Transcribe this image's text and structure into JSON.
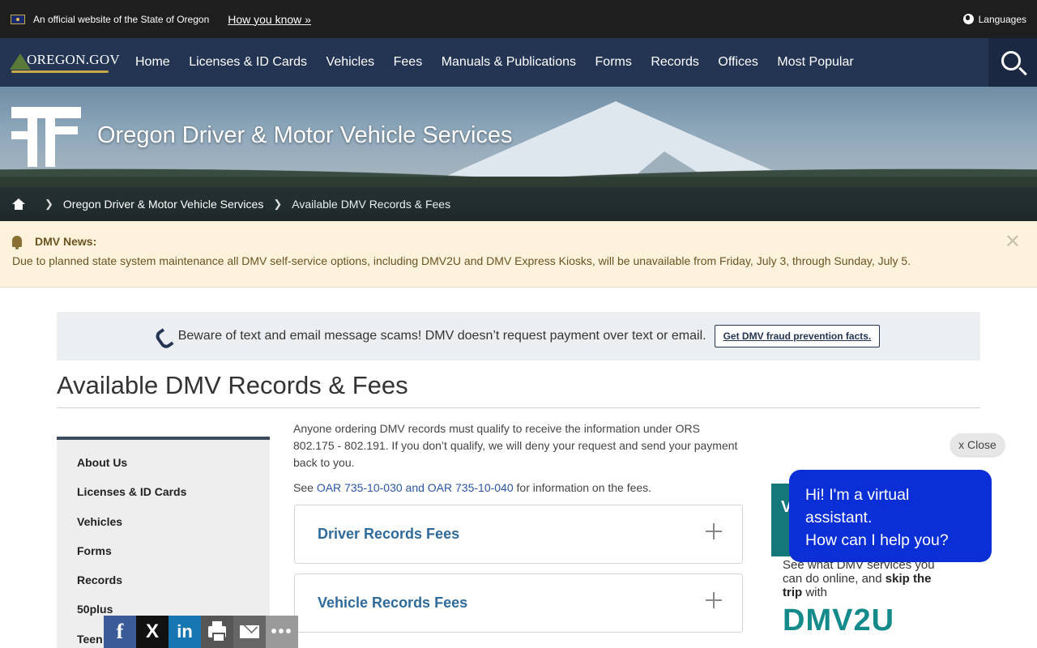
{
  "topbar": {
    "official_text": "An official website of the State of Oregon",
    "how_you_know": "How you know »",
    "languages": "Languages"
  },
  "nav": {
    "logo_text": "OREGON.GOV",
    "items": [
      "Home",
      "Licenses & ID Cards",
      "Vehicles",
      "Fees",
      "Manuals & Publications",
      "Forms",
      "Records",
      "Offices",
      "Most Popular"
    ]
  },
  "hero": {
    "title": "Oregon Driver & Motor Vehicle Services",
    "breadcrumb": [
      "Oregon Driver & Motor Vehicle Services",
      "Available DMV Records & Fees"
    ]
  },
  "alert": {
    "label": "DMV News:",
    "message": "Due to planned state system maintenance all DMV self-service options, including DMV2U and DMV Express Kiosks, will be unavailable from Friday, July 3, through Sunday, July 5.",
    "close": "✕"
  },
  "scam": {
    "text": "Beware of text and email message scams! DMV doesn’t request payment over text or email.",
    "button": "Get DMV fraud prevention facts."
  },
  "page_title": "Available DMV Records & Fees",
  "sidebar": {
    "items": [
      "About Us",
      "Licenses & ID Cards",
      "Vehicles",
      "Forms",
      "Records",
      "50plus",
      "Teen"
    ]
  },
  "content": {
    "intro": "Anyone ordering DMV records must qualify to receive the information under ORS 802.175 - 802.191. If you don’t qualify, we will deny your request and send your payment back to you.",
    "see_prefix": "See ",
    "see_link": "OAR 735-10-030 and OAR 735-10-040",
    "see_suffix": " for information on the fees.",
    "accordions": [
      "Driver Records Fees",
      "Vehicle Records Fees"
    ]
  },
  "promo": {
    "letter": "V",
    "line1": "See what DMV services you can do online, and",
    "bold": "skip the trip",
    "line2": " with",
    "brand": "DMV2U"
  },
  "chat": {
    "close": "x Close",
    "line1": "Hi! I'm a virtual assistant.",
    "line2": "How can I help you?"
  },
  "share": {
    "facebook": "f",
    "x": "X",
    "linkedin": "in",
    "more": "•••"
  },
  "colors": {
    "topbar": "#1e1e1e",
    "nav": "#243554",
    "alert_bg": "#fdf3dc",
    "chat": "#0a2fd6",
    "accordion_label": "#2f6a9b",
    "brand_teal": "#148a8a"
  }
}
